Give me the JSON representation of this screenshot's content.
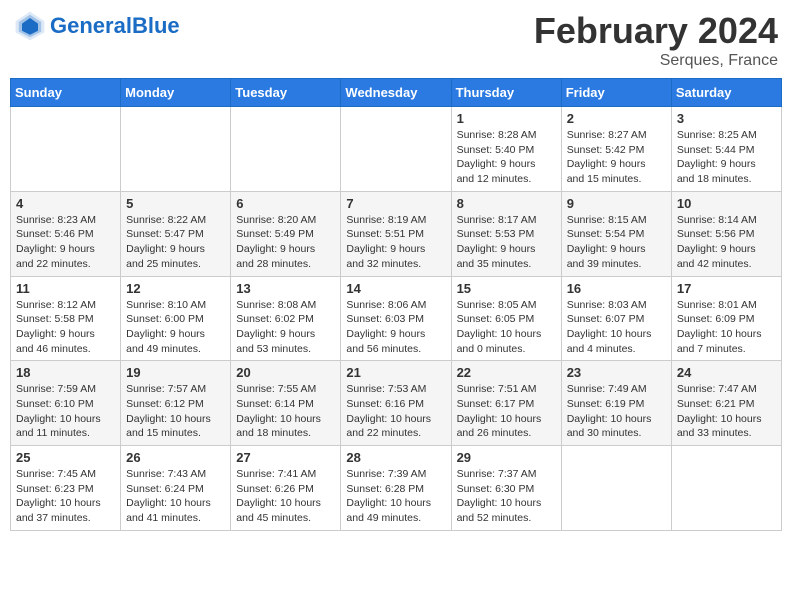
{
  "header": {
    "logo_general": "General",
    "logo_blue": "Blue",
    "month_title": "February 2024",
    "location": "Serques, France"
  },
  "weekdays": [
    "Sunday",
    "Monday",
    "Tuesday",
    "Wednesday",
    "Thursday",
    "Friday",
    "Saturday"
  ],
  "weeks": [
    [
      {
        "day": "",
        "info": ""
      },
      {
        "day": "",
        "info": ""
      },
      {
        "day": "",
        "info": ""
      },
      {
        "day": "",
        "info": ""
      },
      {
        "day": "1",
        "info": "Sunrise: 8:28 AM\nSunset: 5:40 PM\nDaylight: 9 hours\nand 12 minutes."
      },
      {
        "day": "2",
        "info": "Sunrise: 8:27 AM\nSunset: 5:42 PM\nDaylight: 9 hours\nand 15 minutes."
      },
      {
        "day": "3",
        "info": "Sunrise: 8:25 AM\nSunset: 5:44 PM\nDaylight: 9 hours\nand 18 minutes."
      }
    ],
    [
      {
        "day": "4",
        "info": "Sunrise: 8:23 AM\nSunset: 5:46 PM\nDaylight: 9 hours\nand 22 minutes."
      },
      {
        "day": "5",
        "info": "Sunrise: 8:22 AM\nSunset: 5:47 PM\nDaylight: 9 hours\nand 25 minutes."
      },
      {
        "day": "6",
        "info": "Sunrise: 8:20 AM\nSunset: 5:49 PM\nDaylight: 9 hours\nand 28 minutes."
      },
      {
        "day": "7",
        "info": "Sunrise: 8:19 AM\nSunset: 5:51 PM\nDaylight: 9 hours\nand 32 minutes."
      },
      {
        "day": "8",
        "info": "Sunrise: 8:17 AM\nSunset: 5:53 PM\nDaylight: 9 hours\nand 35 minutes."
      },
      {
        "day": "9",
        "info": "Sunrise: 8:15 AM\nSunset: 5:54 PM\nDaylight: 9 hours\nand 39 minutes."
      },
      {
        "day": "10",
        "info": "Sunrise: 8:14 AM\nSunset: 5:56 PM\nDaylight: 9 hours\nand 42 minutes."
      }
    ],
    [
      {
        "day": "11",
        "info": "Sunrise: 8:12 AM\nSunset: 5:58 PM\nDaylight: 9 hours\nand 46 minutes."
      },
      {
        "day": "12",
        "info": "Sunrise: 8:10 AM\nSunset: 6:00 PM\nDaylight: 9 hours\nand 49 minutes."
      },
      {
        "day": "13",
        "info": "Sunrise: 8:08 AM\nSunset: 6:02 PM\nDaylight: 9 hours\nand 53 minutes."
      },
      {
        "day": "14",
        "info": "Sunrise: 8:06 AM\nSunset: 6:03 PM\nDaylight: 9 hours\nand 56 minutes."
      },
      {
        "day": "15",
        "info": "Sunrise: 8:05 AM\nSunset: 6:05 PM\nDaylight: 10 hours\nand 0 minutes."
      },
      {
        "day": "16",
        "info": "Sunrise: 8:03 AM\nSunset: 6:07 PM\nDaylight: 10 hours\nand 4 minutes."
      },
      {
        "day": "17",
        "info": "Sunrise: 8:01 AM\nSunset: 6:09 PM\nDaylight: 10 hours\nand 7 minutes."
      }
    ],
    [
      {
        "day": "18",
        "info": "Sunrise: 7:59 AM\nSunset: 6:10 PM\nDaylight: 10 hours\nand 11 minutes."
      },
      {
        "day": "19",
        "info": "Sunrise: 7:57 AM\nSunset: 6:12 PM\nDaylight: 10 hours\nand 15 minutes."
      },
      {
        "day": "20",
        "info": "Sunrise: 7:55 AM\nSunset: 6:14 PM\nDaylight: 10 hours\nand 18 minutes."
      },
      {
        "day": "21",
        "info": "Sunrise: 7:53 AM\nSunset: 6:16 PM\nDaylight: 10 hours\nand 22 minutes."
      },
      {
        "day": "22",
        "info": "Sunrise: 7:51 AM\nSunset: 6:17 PM\nDaylight: 10 hours\nand 26 minutes."
      },
      {
        "day": "23",
        "info": "Sunrise: 7:49 AM\nSunset: 6:19 PM\nDaylight: 10 hours\nand 30 minutes."
      },
      {
        "day": "24",
        "info": "Sunrise: 7:47 AM\nSunset: 6:21 PM\nDaylight: 10 hours\nand 33 minutes."
      }
    ],
    [
      {
        "day": "25",
        "info": "Sunrise: 7:45 AM\nSunset: 6:23 PM\nDaylight: 10 hours\nand 37 minutes."
      },
      {
        "day": "26",
        "info": "Sunrise: 7:43 AM\nSunset: 6:24 PM\nDaylight: 10 hours\nand 41 minutes."
      },
      {
        "day": "27",
        "info": "Sunrise: 7:41 AM\nSunset: 6:26 PM\nDaylight: 10 hours\nand 45 minutes."
      },
      {
        "day": "28",
        "info": "Sunrise: 7:39 AM\nSunset: 6:28 PM\nDaylight: 10 hours\nand 49 minutes."
      },
      {
        "day": "29",
        "info": "Sunrise: 7:37 AM\nSunset: 6:30 PM\nDaylight: 10 hours\nand 52 minutes."
      },
      {
        "day": "",
        "info": ""
      },
      {
        "day": "",
        "info": ""
      }
    ]
  ]
}
